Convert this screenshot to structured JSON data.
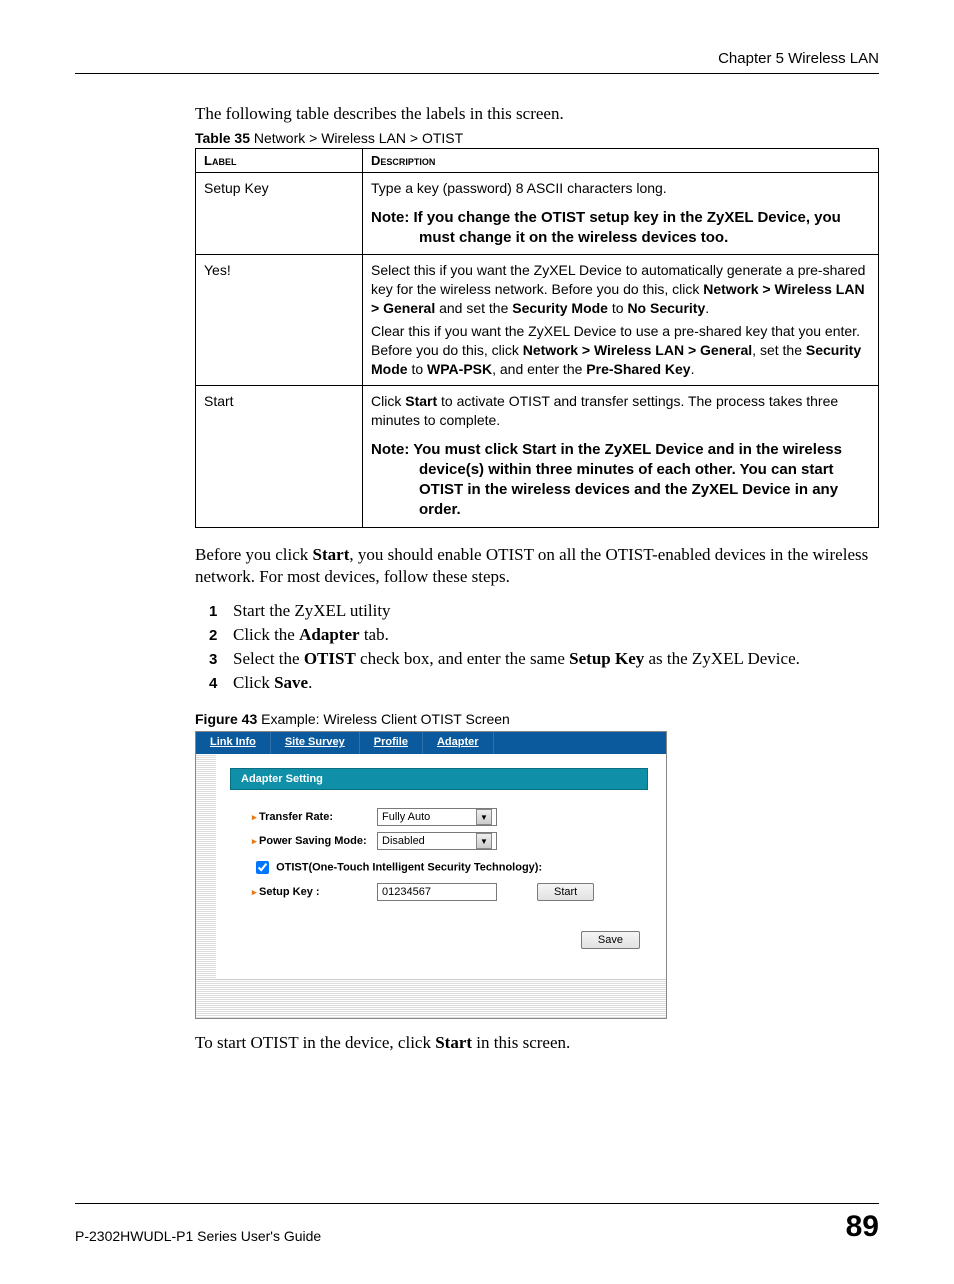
{
  "header": {
    "chapter": "Chapter 5 Wireless LAN"
  },
  "intro": "The following table describes the labels in this screen.",
  "table_caption_bold": "Table 35",
  "table_caption_rest": "   Network > Wireless LAN > OTIST",
  "table": {
    "col1": "Label",
    "col2": "Description",
    "rows": {
      "setup_key_label": "Setup Key",
      "setup_key_desc1": "Type a key (password) 8 ASCII characters long.",
      "setup_key_note": "Note: If you change the OTIST setup key in the ZyXEL Device, you must change it on the wireless devices too.",
      "yes_label": "Yes!",
      "yes_desc_p1a": "Select this if you want the ZyXEL Device to automatically generate a pre-shared key for the wireless network. Before you do this, click ",
      "yes_desc_p1b": "Network > Wireless LAN > General",
      "yes_desc_p1c": " and set the ",
      "yes_desc_p1d": "Security Mode",
      "yes_desc_p1e": " to ",
      "yes_desc_p1f": "No Security",
      "yes_desc_p1g": ".",
      "yes_desc_p2a": "Clear this if you want the ZyXEL Device to use a pre-shared key that you enter. Before you do this, click ",
      "yes_desc_p2b": "Network > Wireless LAN > General",
      "yes_desc_p2c": ", set the ",
      "yes_desc_p2d": "Security Mode",
      "yes_desc_p2e": " to ",
      "yes_desc_p2f": "WPA-PSK",
      "yes_desc_p2g": ", and enter the ",
      "yes_desc_p2h": "Pre-Shared Key",
      "yes_desc_p2i": ".",
      "start_label": "Start",
      "start_desc_a": "Click ",
      "start_desc_b": "Start",
      "start_desc_c": " to activate OTIST and transfer settings. The process takes three minutes to complete.",
      "start_note": "Note: You must click Start in the ZyXEL Device and in the wireless device(s) within three minutes of each other. You can start OTIST in the wireless devices and the ZyXEL Device in any order."
    }
  },
  "after_table_a": "Before you click ",
  "after_table_b": "Start",
  "after_table_c": ", you should enable OTIST on all the OTIST-enabled devices in the wireless network. For most devices, follow these steps.",
  "steps": {
    "n1": "1",
    "s1": "Start the ZyXEL utility",
    "n2": "2",
    "s2a": "Click the ",
    "s2b": "Adapter",
    "s2c": " tab.",
    "n3": "3",
    "s3a": "Select the ",
    "s3b": "OTIST",
    "s3c": " check box, and enter the same ",
    "s3d": "Setup Key",
    "s3e": " as the ZyXEL Device.",
    "n4": "4",
    "s4a": "Click ",
    "s4b": "Save",
    "s4c": "."
  },
  "figure_caption_bold": "Figure 43",
  "figure_caption_rest": "   Example: Wireless Client OTIST Screen",
  "figure": {
    "tabs": {
      "link_info": "Link Info",
      "site_survey": "Site Survey",
      "profile": "Profile",
      "adapter": "Adapter"
    },
    "adapter_setting": "Adapter Setting",
    "transfer_rate_label": "Transfer Rate:",
    "transfer_rate_value": "Fully Auto",
    "power_saving_label": "Power Saving Mode:",
    "power_saving_value": "Disabled",
    "otist_checkbox_label": "OTIST(One-Touch Intelligent Security Technology):",
    "setup_key_label": "Setup Key :",
    "setup_key_value": "01234567",
    "start_btn": "Start",
    "save_btn": "Save"
  },
  "after_fig_a": "To start OTIST in the device, click ",
  "after_fig_b": "Start",
  "after_fig_c": " in this screen.",
  "footer": {
    "guide": "P-2302HWUDL-P1 Series User's Guide",
    "page": "89"
  }
}
